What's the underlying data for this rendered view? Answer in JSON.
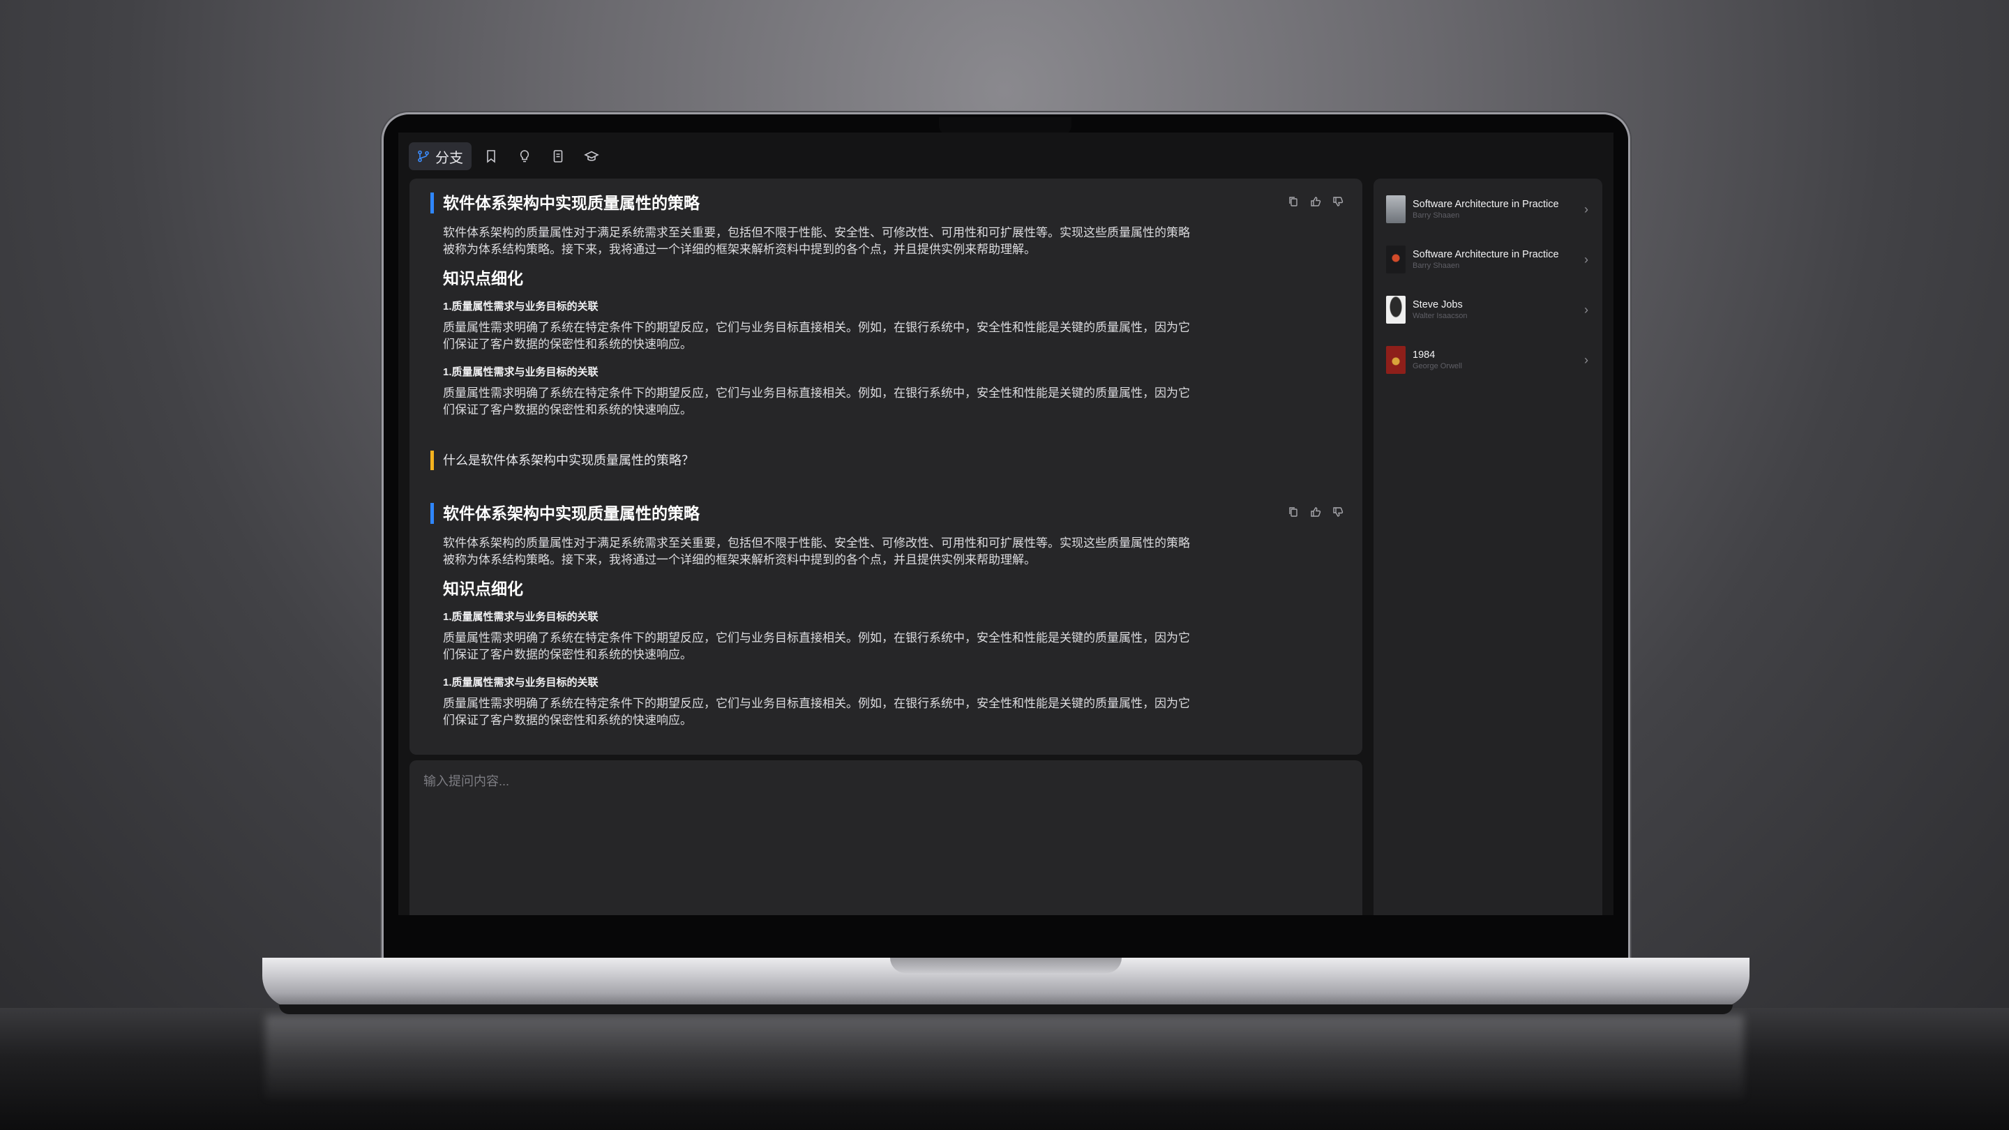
{
  "toolbar": {
    "branch_label": "分支",
    "icons": [
      "branch-icon",
      "bookmark-icon",
      "lightbulb-icon",
      "note-icon",
      "graduation-cap-icon"
    ]
  },
  "messages": [
    {
      "title": "软件体系架构中实现质量属性的策略",
      "intro_line1": "软件体系架构的质量属性对于满足系统需求至关重要，包括但不限于性能、安全性、可修改性、可用性和可扩展性等。实现这些质量属性的策略",
      "intro_line2": "被称为体系结构策略。接下来，我将通过一个详细的框架来解析资料中提到的各个点，并且提供实例来帮助理解。",
      "section": "知识点细化",
      "items": [
        {
          "heading": "1.质量属性需求与业务目标的关联",
          "line1": "质量属性需求明确了系统在特定条件下的期望反应，它们与业务目标直接相关。例如，在银行系统中，安全性和性能是关键的质量属性，因为它",
          "line2": "们保证了客户数据的保密性和系统的快速响应。"
        },
        {
          "heading": "1.质量属性需求与业务目标的关联",
          "line1": "质量属性需求明确了系统在特定条件下的期望反应，它们与业务目标直接相关。例如，在银行系统中，安全性和性能是关键的质量属性，因为它",
          "line2": "们保证了客户数据的保密性和系统的快速响应。"
        }
      ]
    },
    {
      "title": "软件体系架构中实现质量属性的策略",
      "intro_line1": "软件体系架构的质量属性对于满足系统需求至关重要，包括但不限于性能、安全性、可修改性、可用性和可扩展性等。实现这些质量属性的策略",
      "intro_line2": "被称为体系结构策略。接下来，我将通过一个详细的框架来解析资料中提到的各个点，并且提供实例来帮助理解。",
      "section": "知识点细化",
      "items": [
        {
          "heading": "1.质量属性需求与业务目标的关联",
          "line1": "质量属性需求明确了系统在特定条件下的期望反应，它们与业务目标直接相关。例如，在银行系统中，安全性和性能是关键的质量属性，因为它",
          "line2": "们保证了客户数据的保密性和系统的快速响应。"
        },
        {
          "heading": "1.质量属性需求与业务目标的关联",
          "line1": "质量属性需求明确了系统在特定条件下的期望反应，它们与业务目标直接相关。例如，在银行系统中，安全性和性能是关键的质量属性，因为它",
          "line2": "们保证了客户数据的保密性和系统的快速响应。"
        }
      ]
    }
  ],
  "question": "什么是软件体系架构中实现质量属性的策略？",
  "message_actions": [
    "copy-icon",
    "thumbs-up-icon",
    "thumbs-down-icon"
  ],
  "input": {
    "placeholder": "输入提问内容..."
  },
  "sidebar": {
    "books": [
      {
        "title": "Software Architecture in Practice",
        "author": "Barry Shaaen",
        "cover_color": "#8a8f96"
      },
      {
        "title": "Software Architecture in Practice",
        "author": "Barry Shaaen",
        "cover_color": "#1a1a1c"
      },
      {
        "title": "Steve Jobs",
        "author": "Walter Isaacson",
        "cover_color": "#e9e9e9"
      },
      {
        "title": "1984",
        "author": "George Orwell",
        "cover_color": "#8e1f1a"
      }
    ]
  },
  "colors": {
    "accent_blue": "#2f86ff",
    "question_yellow": "#f3b21e",
    "panel": "#262628"
  }
}
